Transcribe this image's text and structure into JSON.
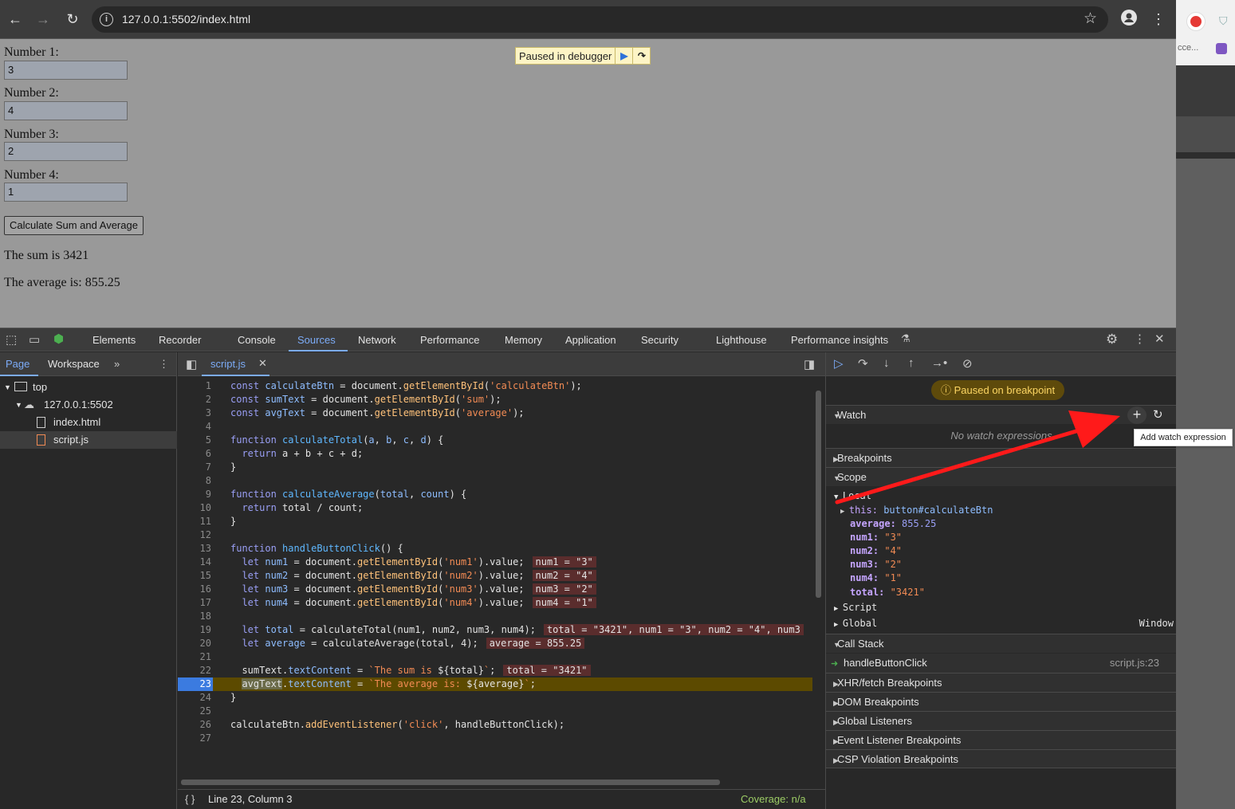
{
  "browser": {
    "url": "127.0.0.1:5502/index.html",
    "back_icon": "arrow-left-icon",
    "forward_icon": "arrow-right-icon",
    "reload_icon": "reload-icon",
    "bookmark_icon": "star-icon",
    "profile_icon": "profile-icon",
    "menu_icon": "kebab-menu-icon"
  },
  "page": {
    "fields": [
      {
        "label": "Number 1:",
        "value": "3"
      },
      {
        "label": "Number 2:",
        "value": "4"
      },
      {
        "label": "Number 3:",
        "value": "2"
      },
      {
        "label": "Number 4:",
        "value": "1"
      }
    ],
    "button_label": "Calculate Sum and Average",
    "sum_text": "The sum is 3421",
    "avg_text": "The average is: 855.25",
    "paused_banner": "Paused in debugger"
  },
  "devtools": {
    "tabs": [
      "Elements",
      "Recorder",
      "Console",
      "Sources",
      "Network",
      "Performance",
      "Memory",
      "Application",
      "Security",
      "Lighthouse",
      "Performance insights"
    ],
    "active_tab": "Sources",
    "navigator": {
      "tabs": [
        "Page",
        "Workspace"
      ],
      "active_tab": "Page",
      "tree": [
        {
          "label": "top",
          "depth": 0
        },
        {
          "label": "127.0.0.1:5502",
          "depth": 1
        },
        {
          "label": "index.html",
          "depth": 2
        },
        {
          "label": "script.js",
          "depth": 2,
          "selected": true
        }
      ]
    },
    "editor": {
      "file_tab": "script.js",
      "current_line": 23,
      "status": "Line 23, Column 3",
      "coverage": "Coverage: n/a",
      "inline_values": {
        "l14": "num1 = \"3\"",
        "l15": "num2 = \"4\"",
        "l16": "num3 = \"2\"",
        "l17": "num4 = \"1\"",
        "l19": "total = \"3421\", num1 = \"3\", num2 = \"4\", num3",
        "l20": "average = 855.25",
        "l22": "total = \"3421\""
      }
    },
    "debugger": {
      "status_pill": "Paused on breakpoint",
      "watch": {
        "title": "Watch",
        "empty": "No watch expressions",
        "tooltip": "Add watch expression"
      },
      "breakpoints_title": "Breakpoints",
      "scope_title": "Scope",
      "local_title": "Local",
      "scope_vars": [
        {
          "name": "this",
          "value": "button#calculateBtn",
          "kind": "object"
        },
        {
          "name": "average",
          "value": "855.25",
          "kind": "number"
        },
        {
          "name": "num1",
          "value": "\"3\"",
          "kind": "string"
        },
        {
          "name": "num2",
          "value": "\"4\"",
          "kind": "string"
        },
        {
          "name": "num3",
          "value": "\"2\"",
          "kind": "string"
        },
        {
          "name": "num4",
          "value": "\"1\"",
          "kind": "string"
        },
        {
          "name": "total",
          "value": "\"3421\"",
          "kind": "string"
        }
      ],
      "script_title": "Script",
      "global_title": "Global",
      "global_value": "Window",
      "callstack_title": "Call Stack",
      "callstack": [
        {
          "fn": "handleButtonClick",
          "loc": "script.js:23"
        }
      ],
      "more_sections": [
        "XHR/fetch Breakpoints",
        "DOM Breakpoints",
        "Global Listeners",
        "Event Listener Breakpoints",
        "CSP Violation Breakpoints"
      ]
    }
  },
  "side_window": {
    "text": "cce..."
  },
  "annotation": {
    "color": "#ff1a1a"
  }
}
